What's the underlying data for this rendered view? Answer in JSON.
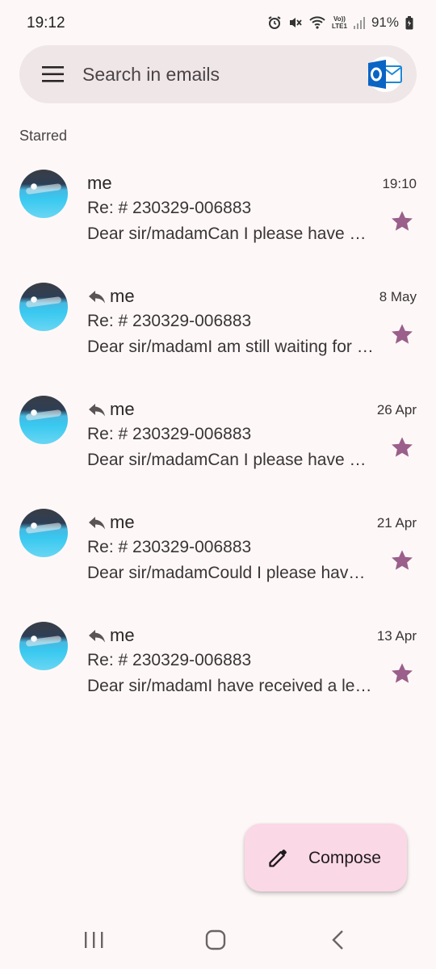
{
  "status_bar": {
    "time": "19:12",
    "battery": "91%",
    "network_label_top": "Vo))",
    "network_label_bottom": "LTE1",
    "icons": [
      "alarm-icon",
      "mute-icon",
      "wifi-icon",
      "signal-icon",
      "battery-icon"
    ]
  },
  "search": {
    "placeholder": "Search in emails",
    "account_icon": "outlook-icon",
    "account_letter": "O"
  },
  "section_label": "Starred",
  "emails": [
    {
      "sender": "me",
      "replied": false,
      "date": "19:10",
      "subject": "Re: # 230329-006883",
      "snippet": "Dear sir/madamCan I please have a copy of the letter",
      "starred": true
    },
    {
      "sender": "me",
      "replied": true,
      "date": "8 May",
      "subject": "Re: # 230329-006883",
      "snippet": "Dear sir/madamI am still waiting for a response",
      "starred": true
    },
    {
      "sender": "me",
      "replied": true,
      "date": "26 Apr",
      "subject": "Re: # 230329-006883",
      "snippet": "Dear sir/madamCan I please have a copy of the letter",
      "starred": true
    },
    {
      "sender": "me",
      "replied": true,
      "date": "21 Apr",
      "subject": "Re: # 230329-006883",
      "snippet": "Dear sir/madamCould I please have an update",
      "starred": true
    },
    {
      "sender": "me",
      "replied": true,
      "date": "13 Apr",
      "subject": "Re: # 230329-006883",
      "snippet": "Dear sir/madamI have received a letter",
      "starred": true
    }
  ],
  "compose": {
    "label": "Compose"
  },
  "colors": {
    "star": "#9a5f8a",
    "compose_bg": "#fbd8e6",
    "search_bg": "#efe6e7",
    "background": "#fdf8f7"
  }
}
